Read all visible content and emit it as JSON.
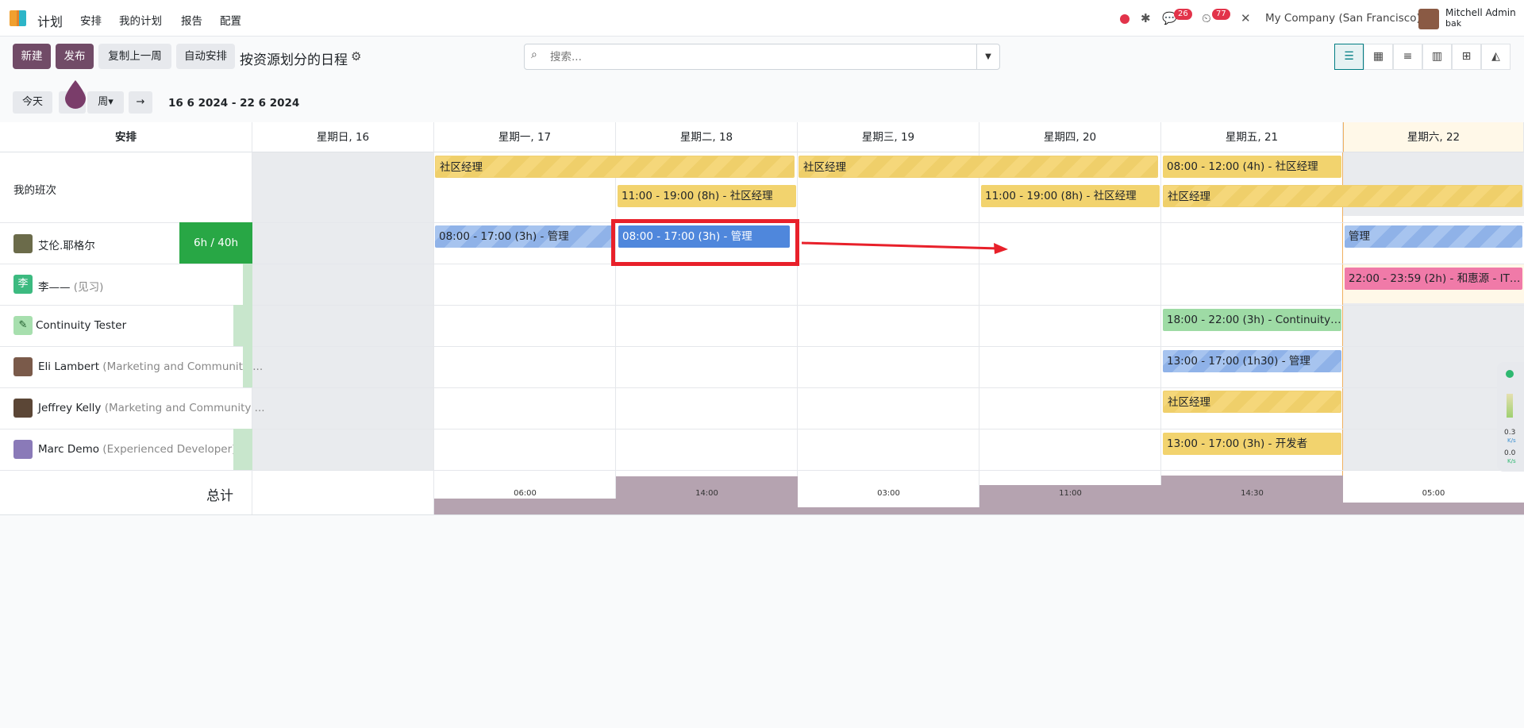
{
  "nav": {
    "app_name": "计划",
    "menu": [
      "安排",
      "我的计划",
      "报告",
      "配置"
    ],
    "messages_badge": "26",
    "activities_badge": "77",
    "company": "My Company (San Francisco)",
    "user_name": "Mitchell Admin",
    "user_db": "bak"
  },
  "toolbar": {
    "new_label": "新建",
    "publish_label": "发布",
    "copy_label": "复制上一周",
    "auto_label": "自动安排",
    "view_title": "按资源划分的日程",
    "search_placeholder": "搜索...",
    "today_label": "今天",
    "scale_label": "周",
    "date_range": "16 6 2024 - 22 6 2024"
  },
  "gantt": {
    "header_label": "安排",
    "days": [
      "星期日, 16",
      "星期一, 17",
      "星期二, 18",
      "星期三, 19",
      "星期四, 20",
      "星期五, 21",
      "星期六, 22"
    ],
    "rows": [
      {
        "name": "我的班次",
        "sub": ""
      },
      {
        "name": "艾伦.耶格尔",
        "sub": "",
        "capacity": "6h / 40h (0%)"
      },
      {
        "name": "李——",
        "sub": "(见习)",
        "initial": "李"
      },
      {
        "name": "Continuity Tester",
        "sub": ""
      },
      {
        "name": "Eli Lambert",
        "sub": "(Marketing and Community ..."
      },
      {
        "name": "Jeffrey Kelly",
        "sub": "(Marketing and Community ..."
      },
      {
        "name": "Marc Demo",
        "sub": "(Experienced Developer)"
      }
    ],
    "pills": {
      "p1": "社区经理",
      "p2": "社区经理",
      "p3": "08:00 - 12:00 (4h) - 社区经理",
      "p4": "11:00 - 19:00 (8h) - 社区经理",
      "p5": "11:00 - 19:00 (8h) - 社区经理",
      "p6": "社区经理",
      "p7": "08:00 - 17:00 (3h) - 管理",
      "p8": "08:00 - 17:00 (3h) - 管理",
      "p9": "管理",
      "p10": "22:00 - 23:59 (2h) - 和惠源 - IT技...",
      "p11": "18:00 - 22:00 (3h) - Continuity Te...",
      "p12": "13:00 - 17:00 (1h30) - 管理",
      "p13": "社区经理",
      "p14": "13:00 - 17:00 (3h) - 开发者"
    },
    "total_label": "总计",
    "totals": [
      "06:00",
      "14:00",
      "03:00",
      "11:00",
      "14:30",
      "05:00"
    ]
  },
  "widget": {
    "v1": "0.3",
    "u1": "K/s",
    "v2": "0.0",
    "u2": "K/s"
  }
}
